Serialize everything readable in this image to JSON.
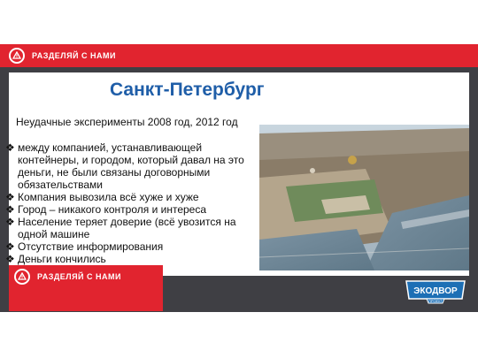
{
  "brand": {
    "tagline": "РАЗДЕЛЯЙ С НАМИ"
  },
  "slide": {
    "title": "Санкт-Петербург",
    "subtitle": "Неудачные эксперименты 2008 год, 2012 год",
    "bullets": [
      "между компанией, устанавливающей контейнеры, и городом, который давал на это деньги, не были связаны договорными обязательствами",
      "Компания вывозила всё хуже и хуже",
      "Город – никакого контроля и интереса",
      "Население теряет доверие (всё увозится на одной машине",
      "Отсутствие информирования",
      "Деньги кончились"
    ],
    "bullet_marker": "❖"
  },
  "logo": {
    "name": "ЭКОДВОР",
    "sub": "ПРОЕКТ"
  },
  "colors": {
    "brand_red": "#e1242f",
    "title_blue": "#1f5ea8",
    "logo_blue": "#1d6fb5",
    "dark_bg": "#3f3f44"
  },
  "icons": {
    "brand": "recycle-warning-icon",
    "photo": "aerial-city-photo"
  }
}
